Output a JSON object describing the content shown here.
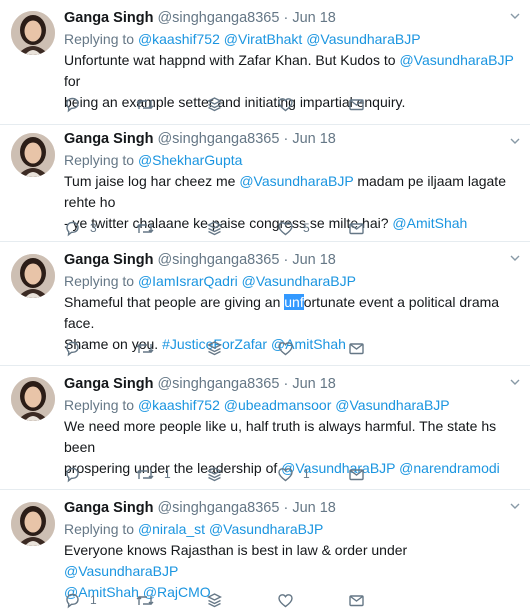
{
  "colors": {
    "link": "#1b95e0",
    "secondary": "#657786",
    "divider": "#e6ecf0",
    "highlight": "#3399ff"
  },
  "tweets": [
    {
      "author": {
        "name": "Ganga Singh",
        "handle": "@singhganga8365",
        "sep": "·",
        "date": "Jun 18"
      },
      "replying_to": {
        "label": "Replying to",
        "mentions": [
          "@kaashif752",
          "@ViratBhakt",
          "@VasundharaBJP"
        ]
      },
      "text": {
        "line1_a": "Unfortunte wat happnd with Zafar Khan. But Kudos to ",
        "line1_link": "@VasundharaBJP",
        "line1_b": " for",
        "line2": "being an example setter and initiating impartial enquiry."
      },
      "stats": {
        "replies": "",
        "retweets": "",
        "likes": ""
      }
    },
    {
      "author": {
        "name": "Ganga Singh",
        "handle": "@singhganga8365",
        "sep": "·",
        "date": "Jun 18"
      },
      "replying_to": {
        "label": "Replying to",
        "mentions": [
          "@ShekharGupta"
        ]
      },
      "text": {
        "line1_a": "Tum jaise log har cheez me ",
        "line1_link": "@VasundharaBJP",
        "line1_b": " madam pe iljaam lagate rehte ho",
        "line2_a": "- ye twitter chalaane ke paise congress se milte hai? ",
        "line2_link": "@AmitShah"
      },
      "stats": {
        "replies": "3",
        "retweets": "",
        "likes": "5"
      }
    },
    {
      "author": {
        "name": "Ganga Singh",
        "handle": "@singhganga8365",
        "sep": "·",
        "date": "Jun 18"
      },
      "replying_to": {
        "label": "Replying to",
        "mentions": [
          "@IamIsrarQadri",
          "@VasundharaBJP"
        ]
      },
      "text": {
        "line1_a": "Shameful that people are giving an ",
        "line1_hl": "unf",
        "line1_b": "ortunate event a political drama face.",
        "line2_a": "Shame on you. ",
        "line2_tag": "#JusticeForZafar",
        "line2_link": "@AmitShah"
      },
      "stats": {
        "replies": "",
        "retweets": "",
        "likes": ""
      }
    },
    {
      "author": {
        "name": "Ganga Singh",
        "handle": "@singhganga8365",
        "sep": "·",
        "date": "Jun 18"
      },
      "replying_to": {
        "label": "Replying to",
        "mentions": [
          "@kaashif752",
          "@ubeadmansoor",
          "@VasundharaBJP"
        ]
      },
      "text": {
        "line1": "We need more people like u, half truth is always harmful. The state hs been",
        "line2_a": "prospering under the leadership of ",
        "line2_link1": "@VasundharaBJP",
        "line2_link2": "@narendramodi"
      },
      "stats": {
        "replies": "",
        "retweets": "1",
        "likes": "1"
      }
    },
    {
      "author": {
        "name": "Ganga Singh",
        "handle": "@singhganga8365",
        "sep": "·",
        "date": "Jun 18"
      },
      "replying_to": {
        "label": "Replying to",
        "mentions": [
          "@nirala_st",
          "@VasundharaBJP"
        ]
      },
      "text": {
        "line1_a": "Everyone knows Rajasthan is best in law & order under ",
        "line1_link": "@VasundharaBJP",
        "line2_link1": "@AmitShah",
        "line2_link2": "@RajCMO"
      },
      "stats": {
        "replies": "1",
        "retweets": "",
        "likes": ""
      }
    }
  ]
}
